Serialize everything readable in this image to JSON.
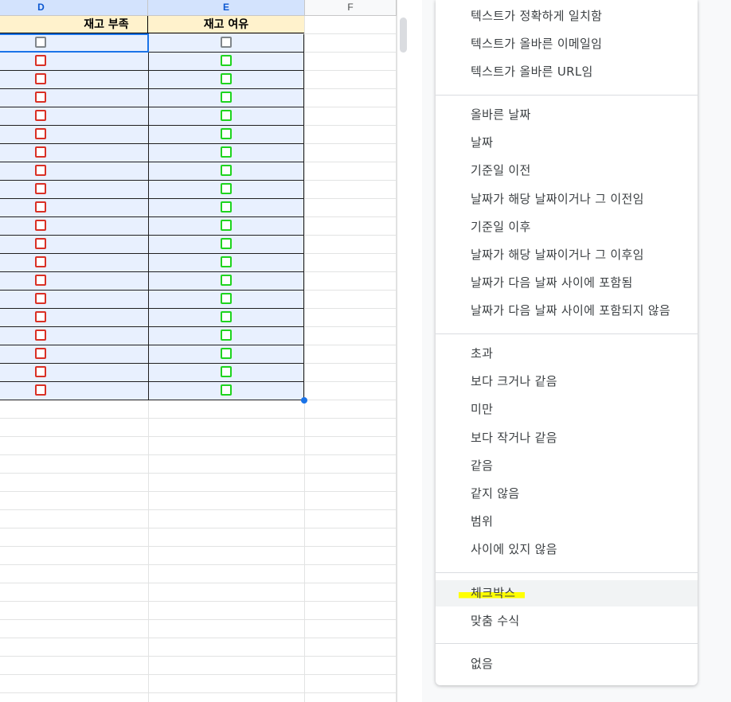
{
  "sheet": {
    "columns": [
      {
        "letter": "D",
        "selected": true
      },
      {
        "letter": "E",
        "selected": true
      },
      {
        "letter": "F",
        "selected": false
      }
    ],
    "headers": {
      "d": "재고 부족",
      "e": "재고 여유"
    },
    "data_rows": 20,
    "colors": {
      "shortage_checkbox": "#d93025",
      "surplus_checkbox": "#1ed41e",
      "header_fill": "#fff2cc",
      "selection_fill": "#e8f0fe"
    }
  },
  "menu": {
    "group_text": [
      "텍스트가 정확하게 일치함",
      "텍스트가 올바른 이메일임",
      "텍스트가 올바른 URL임"
    ],
    "group_date": [
      "올바른 날짜",
      "날짜",
      "기준일 이전",
      "날짜가 해당 날짜이거나 그 이전임",
      "기준일 이후",
      "날짜가 해당 날짜이거나 그 이후임",
      "날짜가 다음 날짜 사이에 포함됨",
      "날짜가 다음 날짜 사이에 포함되지 않음"
    ],
    "group_number": [
      "초과",
      "보다 크거나 같음",
      "미만",
      "보다 작거나 같음",
      "같음",
      "같지 않음",
      "범위",
      "사이에 있지 않음"
    ],
    "group_other": [
      "체크박스",
      "맞춤 수식"
    ],
    "group_none": [
      "없음"
    ],
    "highlighted_item": "체크박스"
  }
}
